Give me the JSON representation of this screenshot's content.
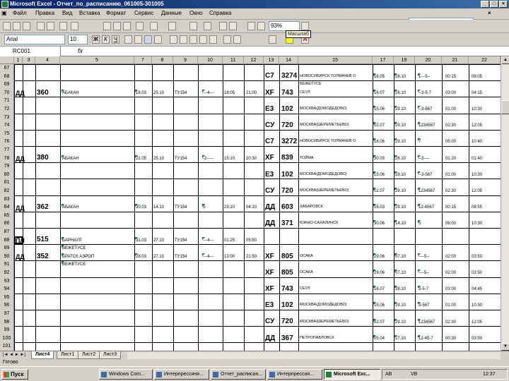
{
  "window": {
    "title": "Microsoft Excel - Отчет_по_расписанию_061005-301005"
  },
  "menu": [
    "Файл",
    "Правка",
    "Вид",
    "Вставка",
    "Формат",
    "Сервис",
    "Данные",
    "Окно",
    "Справка"
  ],
  "ask": {
    "placeholder": "Введите вопрос"
  },
  "toolbar": {
    "zoom": "93%",
    "font": "Arial",
    "size": "10",
    "tooltip": "Масштаб"
  },
  "formula": {
    "namebox": "RC001",
    "fx": "fx"
  },
  "columns": [
    "1",
    "3",
    "4",
    "5",
    "7",
    "8",
    "9",
    "10",
    "11",
    "12",
    "13",
    "14",
    "15",
    "17",
    "19",
    "20",
    "21",
    "22"
  ],
  "rows": [
    {
      "n": "67"
    },
    {
      "n": "68",
      "c13": "С7",
      "c14": "3274",
      "c15": "НОВОСИБИРСК ТОЛМАЧЕВ О",
      "c17": "16.05",
      "c19": "28.10",
      "c20": "1---5--",
      "c21": "00:15",
      "c22": "09:05"
    },
    {
      "n": "69",
      "c15": "ВЕЖЕТУСЕ"
    },
    {
      "n": "70",
      "c1": "ДД",
      "c3": "360",
      "c5": "АБАКАН",
      "c7": "18.03",
      "c8": "25.10",
      "c9": "ТУ154",
      "c10": "---4---",
      "c11": "18:05",
      "c12": "21:00",
      "c13": "XF",
      "c14": "743",
      "c15": "СЕУЛ",
      "c17": "16.07",
      "c19": "28.10",
      "c20": "--3-5-7",
      "c21": "03:00",
      "c22": "04:15"
    },
    {
      "n": "71"
    },
    {
      "n": "72",
      "c13": "Е3",
      "c14": "102",
      "c15": "МОСКВА(ДОМОДЕДОВО)",
      "c17": "15.06",
      "c19": "29.10",
      "c20": "--3-567",
      "c21": "01:00",
      "c22": "10:30"
    },
    {
      "n": "73"
    },
    {
      "n": "74",
      "c13": "СУ",
      "c14": "720",
      "c15": "МОСКВА(ШЕРЕМЕТЬЕВО)",
      "c17": "02.07",
      "c19": "29.10",
      "c20": "1234567",
      "c21": "02:30",
      "c22": "12:05"
    },
    {
      "n": "75"
    },
    {
      "n": "76",
      "c13": "С7",
      "c14": "3272",
      "c15": "НОВОСИБИРСК ТОЛМАЧЕВ О",
      "c17": "18.06",
      "c19": "29.10",
      "c20": "7",
      "c21": "05:00",
      "c22": "10:40"
    },
    {
      "n": "77"
    },
    {
      "n": "78",
      "c1": "ДД",
      "c3": "380",
      "c5": "АБАКАН",
      "c7": "21.05",
      "c8": "25.10",
      "c9": "ТУ154",
      "c10": "-2-----",
      "c11": "15:10",
      "c12": "20:30",
      "c13": "XF",
      "c14": "839",
      "c15": "ТОЙМА",
      "c17": "30.03",
      "c19": "26.10",
      "c20": "--3----",
      "c21": "01:20",
      "c22": "01:40"
    },
    {
      "n": "79"
    },
    {
      "n": "80",
      "c13": "Е3",
      "c14": "102",
      "c15": "МОСКВА(ДОМОДЕДОВО)",
      "c17": "15.06",
      "c19": "29.10",
      "c20": "--3-567",
      "c21": "01:00",
      "c22": "10:30"
    },
    {
      "n": "81"
    },
    {
      "n": "82",
      "c13": "СУ",
      "c14": "720",
      "c15": "МОСКВА(ШЕРЕМЕТЬЕВО)",
      "c17": "02.07",
      "c19": "29.10",
      "c20": "1234567",
      "c21": "02:30",
      "c22": "12:05"
    },
    {
      "n": "83"
    },
    {
      "n": "84",
      "c1": "ДД",
      "c3": "362",
      "c5": "АБАКАН",
      "c7": "30.03",
      "c8": "14.10",
      "c9": "ТУ154",
      "c10": "5",
      "c11": "23:10",
      "c12": "04:10",
      "c13": "ДД",
      "c14": "603",
      "c15": "ХАБАРОВСК",
      "c17": "16.03",
      "c19": "29.10",
      "c20": "12-4567",
      "c21": "00:15",
      "c22": "06:55"
    },
    {
      "n": "85"
    },
    {
      "n": "86",
      "c13": "ДД",
      "c14": "371",
      "c15": "ЮЖНО-САХАЛИНСК",
      "c17": "30.06",
      "c19": "14.10",
      "c20": "5",
      "c21": "06:00",
      "c22": "10:30"
    },
    {
      "n": "87"
    },
    {
      "n": "88",
      "c1": "ПЛ",
      "c3": "515",
      "c5": "БАРНАУЛ",
      "c7": "31.03",
      "c8": "27.10",
      "c9": "ТУ154",
      "c10": "---4---",
      "c11": "01:25",
      "c12": "05:50"
    },
    {
      "n": "89",
      "c5": "ВЕЖЕТУСЕ"
    },
    {
      "n": "90",
      "c1": "ДД",
      "c3": "352",
      "c5": "БРАТСК АЭРОП",
      "c7": "28.03",
      "c8": "27.10",
      "c9": "ТУ154",
      "c10": "---4---",
      "c11": "13:00",
      "c12": "21:50",
      "c13": "XF",
      "c14": "805",
      "c15": "ОСАКА",
      "c17": "29.06",
      "c19": "07.10",
      "c20": "----5--",
      "c21": "02:00",
      "c22": "03:50"
    },
    {
      "n": "91",
      "c5": "ВЕЖЕТУСЕ"
    },
    {
      "n": "92",
      "c13": "XF",
      "c14": "805",
      "c15": "ОСАКА",
      "c17": "29.06",
      "c19": "07.10",
      "c20": "----5--",
      "c21": "02:00",
      "c22": "03:50"
    },
    {
      "n": "93"
    },
    {
      "n": "94",
      "c13": "XF",
      "c14": "743",
      "c15": "СЕУЛ",
      "c17": "16.07",
      "c19": "28.10",
      "c20": "3-5-7",
      "c21": "03:00",
      "c22": "04:45"
    },
    {
      "n": "95"
    },
    {
      "n": "96",
      "c13": "Е3",
      "c14": "102",
      "c15": "МОСКВА(ДОМОДЕДОВО)",
      "c17": "15.06",
      "c19": "29.10",
      "c20": "3-567",
      "c21": "01:00",
      "c22": "10:30"
    },
    {
      "n": "97"
    },
    {
      "n": "98",
      "c13": "СУ",
      "c14": "720",
      "c15": "МОСКВА(ШЕРЕМЕТЬЕВО)",
      "c17": "02.07",
      "c19": "29.10",
      "c20": "1234567",
      "c21": "02:30",
      "c22": "12:05"
    },
    {
      "n": "99"
    },
    {
      "n": "100",
      "c13": "ДД",
      "c14": "367",
      "c15": "ПЕТРОПАВЛОВСК",
      "c17": "05.04",
      "c19": "27.10",
      "c20": "12-45-7",
      "c21": "00:30",
      "c22": "03:50"
    },
    {
      "n": "101"
    }
  ],
  "sheets": {
    "nav": "|◄ ◄ ► ►|",
    "tabs": [
      "Лист4",
      "Лист1",
      "Лист2",
      "Лист3"
    ]
  },
  "status": "Готово",
  "taskbar": {
    "start": "Пуск",
    "tasks": [
      "Windows Com...",
      "Интерпрессиня...",
      "Отчет_расписан...",
      "Интерпрессия...",
      "Microsoft Exc..."
    ],
    "lang": "AB",
    "tray": "VB",
    "clock": "12:37"
  }
}
